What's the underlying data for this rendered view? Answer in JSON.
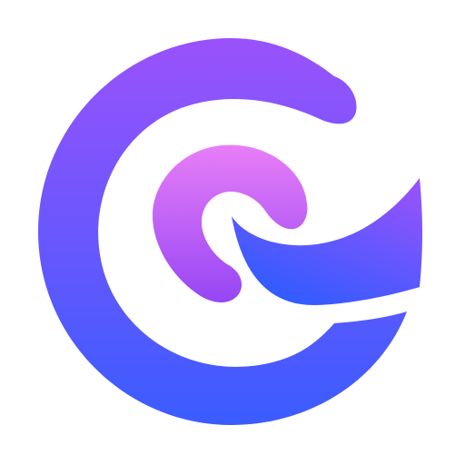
{
  "logo": {
    "icon": "swirl-logo-icon",
    "colors": {
      "outer_top": "#9a52fb",
      "outer_bottom": "#3a5cff",
      "inner_top": "#e87ef7",
      "inner_bottom": "#9646f5",
      "wave_top": "#9a52fb",
      "wave_bottom": "#2f5cff",
      "background": "#ffffff"
    }
  }
}
